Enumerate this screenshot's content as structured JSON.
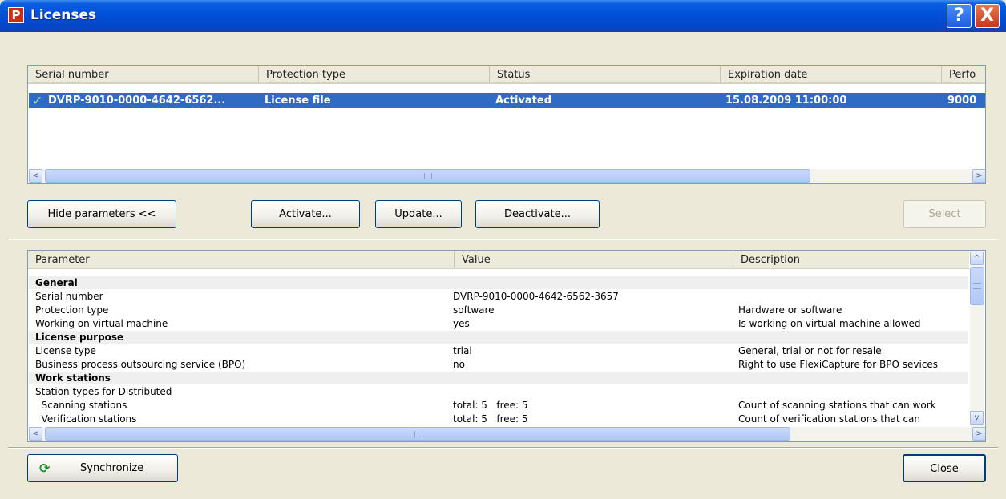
{
  "window": {
    "title": "Licenses",
    "title_icon_glyph": "P",
    "help_glyph": "?",
    "close_glyph": "X"
  },
  "licenses": {
    "columns": [
      "Serial number",
      "Protection type",
      "Status",
      "Expiration date",
      "Perfo"
    ],
    "rows": [
      {
        "check_glyph": "✓",
        "serial": "DVRP-9010-0000-4642-6562...",
        "protection": "License file",
        "status": "Activated",
        "expiration": "15.08.2009 11:00:00",
        "performance": "9000"
      }
    ]
  },
  "scroll": {
    "left_glyph": "<",
    "right_glyph": ">",
    "up_glyph": "^",
    "down_glyph": "v"
  },
  "buttons": {
    "hide_parameters": "Hide parameters <<",
    "activate": "Activate...",
    "update": "Update...",
    "deactivate": "Deactivate...",
    "select": "Select",
    "synchronize": "Synchronize",
    "sync_icon_glyph": "⟳",
    "close": "Close"
  },
  "parameters": {
    "columns": [
      "Parameter",
      "Value",
      "Description"
    ],
    "rows": [
      {
        "param": "General",
        "value": "",
        "desc": "",
        "group": true
      },
      {
        "param": "Serial number",
        "value": "DVRP-9010-0000-4642-6562-3657",
        "desc": ""
      },
      {
        "param": "Protection type",
        "value": "software",
        "desc": "Hardware or software"
      },
      {
        "param": "Working on virtual machine",
        "value": "yes",
        "desc": "Is working on virtual machine allowed"
      },
      {
        "param": "License purpose",
        "value": "",
        "desc": "",
        "group": true
      },
      {
        "param": "License type",
        "value": "trial",
        "desc": "General, trial or not for resale"
      },
      {
        "param": "Business process outsourcing service (BPO)",
        "value": "no",
        "desc": "Right to use FlexiCapture for BPO sevices"
      },
      {
        "param": "Work stations",
        "value": "",
        "desc": "",
        "group": true
      },
      {
        "param": "Station types for Distributed",
        "value": "",
        "desc": ""
      },
      {
        "param": "  Scanning stations",
        "value": "total: 5   free: 5",
        "desc": "Count of scanning stations that can work"
      },
      {
        "param": "  Verification stations",
        "value": "total: 5   free: 5",
        "desc": "Count of verification stations that can"
      }
    ]
  },
  "colors": {
    "selection": "#316ac5",
    "dialog_background": "#ece9d8",
    "title_bar": "#0050d8"
  }
}
